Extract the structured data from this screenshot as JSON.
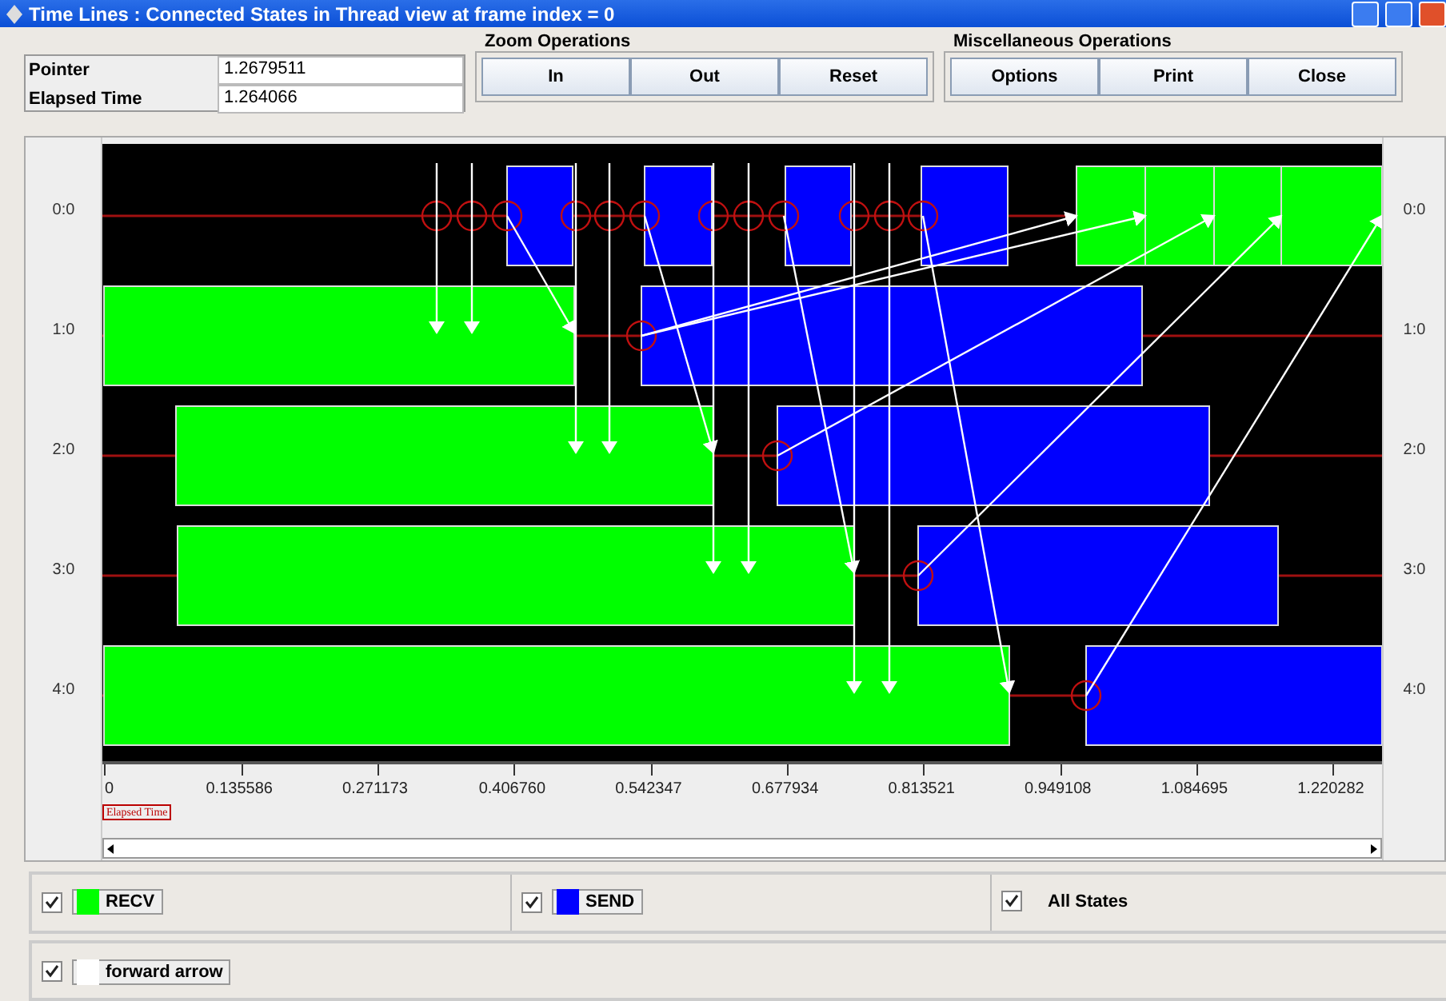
{
  "window": {
    "title": "Time Lines : Connected States in Thread view at frame index = 0"
  },
  "readouts": [
    {
      "label": "Pointer",
      "value": "1.2679511"
    },
    {
      "label": "Elapsed Time",
      "value": "1.264066"
    }
  ],
  "zoom_operations": {
    "title": "Zoom Operations",
    "buttons": [
      "In",
      "Out",
      "Reset"
    ]
  },
  "misc_operations": {
    "title": "Miscellaneous Operations",
    "buttons": [
      "Options",
      "Print",
      "Close"
    ]
  },
  "threads": [
    "0:0",
    "1:0",
    "2:0",
    "3:0",
    "4:0"
  ],
  "threads_right": [
    "0:0",
    "1:0",
    "2:0",
    "3:0",
    "4:0"
  ],
  "axis": {
    "ticks": [
      "0",
      "0.135586",
      "0.271173",
      "0.406760",
      "0.542347",
      "0.677934",
      "0.813521",
      "0.949108",
      "1.084695",
      "1.220282"
    ],
    "caption": "Elapsed Time"
  },
  "legend": [
    {
      "label": "RECV",
      "checked": true,
      "color": "#00ff00"
    },
    {
      "label": "SEND",
      "checked": true,
      "color": "#0000ff"
    },
    {
      "label": "All States",
      "checked": true
    },
    {
      "label": "forward arrow",
      "checked": true,
      "color": "#ffffff"
    }
  ]
}
